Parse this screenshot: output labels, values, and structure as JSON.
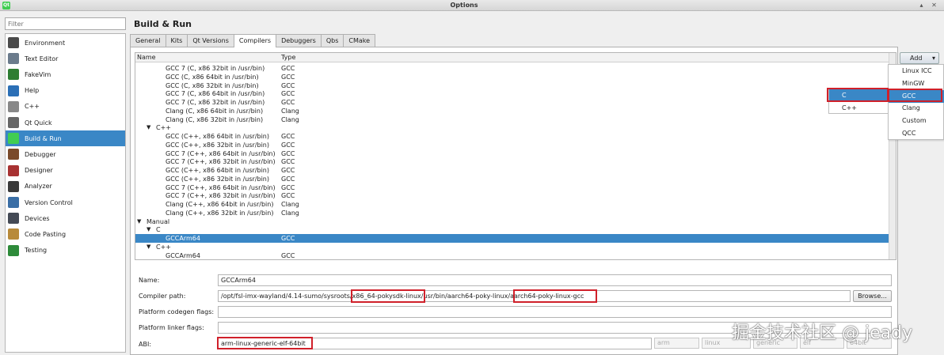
{
  "window": {
    "title": "Options",
    "controls": [
      "▴",
      "✕"
    ]
  },
  "filter": {
    "placeholder": "Filter"
  },
  "sidebar": {
    "items": [
      {
        "label": "Environment",
        "icon": "environment-icon",
        "color": "#4a4a4a"
      },
      {
        "label": "Text Editor",
        "icon": "text-editor-icon",
        "color": "#6b7b8c"
      },
      {
        "label": "FakeVim",
        "icon": "fakevim-icon",
        "color": "#2e7d32"
      },
      {
        "label": "Help",
        "icon": "help-icon",
        "color": "#2b6fb6"
      },
      {
        "label": "C++",
        "icon": "cpp-icon",
        "color": "#888888"
      },
      {
        "label": "Qt Quick",
        "icon": "qt-quick-icon",
        "color": "#666666"
      },
      {
        "label": "Build & Run",
        "icon": "build-run-icon",
        "color": "#41cd52"
      },
      {
        "label": "Debugger",
        "icon": "debugger-icon",
        "color": "#7a4a2a"
      },
      {
        "label": "Designer",
        "icon": "designer-icon",
        "color": "#a83232"
      },
      {
        "label": "Analyzer",
        "icon": "analyzer-icon",
        "color": "#3a3a3a"
      },
      {
        "label": "Version Control",
        "icon": "version-control-icon",
        "color": "#3a6ea5"
      },
      {
        "label": "Devices",
        "icon": "devices-icon",
        "color": "#444a55"
      },
      {
        "label": "Code Pasting",
        "icon": "code-pasting-icon",
        "color": "#b88a3a"
      },
      {
        "label": "Testing",
        "icon": "testing-icon",
        "color": "#2e8b3a"
      }
    ],
    "selected": "Build & Run"
  },
  "page": {
    "title": "Build & Run"
  },
  "tabs": [
    "General",
    "Kits",
    "Qt Versions",
    "Compilers",
    "Debuggers",
    "Qbs",
    "CMake"
  ],
  "active_tab": "Compilers",
  "tree": {
    "columns": [
      "Name",
      "Type"
    ],
    "rows": [
      {
        "name": "GCC 7 (C, x86 32bit in /usr/bin)",
        "type": "GCC"
      },
      {
        "name": "GCC (C, x86 64bit in /usr/bin)",
        "type": "GCC"
      },
      {
        "name": "GCC (C, x86 32bit in /usr/bin)",
        "type": "GCC"
      },
      {
        "name": "GCC 7 (C, x86 64bit in /usr/bin)",
        "type": "GCC"
      },
      {
        "name": "GCC 7 (C, x86 32bit in /usr/bin)",
        "type": "GCC"
      },
      {
        "name": "Clang (C, x86 64bit in /usr/bin)",
        "type": "Clang"
      },
      {
        "name": "Clang (C, x86 32bit in /usr/bin)",
        "type": "Clang"
      },
      {
        "name": "C++",
        "type": "",
        "group": true
      },
      {
        "name": "GCC (C++, x86 64bit in /usr/bin)",
        "type": "GCC"
      },
      {
        "name": "GCC (C++, x86 32bit in /usr/bin)",
        "type": "GCC"
      },
      {
        "name": "GCC 7 (C++, x86 64bit in /usr/bin)",
        "type": "GCC"
      },
      {
        "name": "GCC 7 (C++, x86 32bit in /usr/bin)",
        "type": "GCC"
      },
      {
        "name": "GCC (C++, x86 64bit in /usr/bin)",
        "type": "GCC"
      },
      {
        "name": "GCC (C++, x86 32bit in /usr/bin)",
        "type": "GCC"
      },
      {
        "name": "GCC 7 (C++, x86 64bit in /usr/bin)",
        "type": "GCC"
      },
      {
        "name": "GCC 7 (C++, x86 32bit in /usr/bin)",
        "type": "GCC"
      },
      {
        "name": "Clang (C++, x86 64bit in /usr/bin)",
        "type": "Clang"
      },
      {
        "name": "Clang (C++, x86 32bit in /usr/bin)",
        "type": "Clang"
      },
      {
        "name": "Manual",
        "type": "",
        "group": true
      },
      {
        "name": "C",
        "type": "",
        "group": true
      },
      {
        "name": "GCCArm64",
        "type": "GCC",
        "selected": true
      },
      {
        "name": "C++",
        "type": "",
        "group": true
      },
      {
        "name": "GCCArm64",
        "type": "GCC"
      }
    ]
  },
  "add_button": {
    "label": "Add"
  },
  "add_menu": {
    "items": [
      "Linux ICC",
      "MinGW",
      "GCC",
      "Clang",
      "Custom",
      "QCC"
    ],
    "highlighted": "GCC"
  },
  "language_submenu": {
    "items": [
      "C",
      "C++"
    ],
    "highlighted": "C"
  },
  "form": {
    "name_label": "Name:",
    "name_value": "GCCArm64",
    "path_label": "Compiler path:",
    "path_part1": "/opt/fsl-imx-wayland/4.14-sumo/sysroots/",
    "path_part2": "x86_64-pokysdk-linux",
    "path_part3": "/usr/bin/aarch64-poky-linux/",
    "path_part4": "aarch64-poky-linux-gcc",
    "browse_label": "Browse...",
    "codegen_label": "Platform codegen flags:",
    "codegen_value": "",
    "linker_label": "Platform linker flags:",
    "linker_value": "",
    "abi_label": "ABI:",
    "abi_value": "arm-linux-generic-elf-64bit",
    "abi_parts": [
      "arm",
      "linux",
      "generic",
      "elf",
      "64bit"
    ]
  },
  "watermark": "掘金技术社区 @ jeady",
  "colors": {
    "selection": "#3a87c6",
    "highlight_box": "#d0202a",
    "qt_green": "#41cd52"
  }
}
